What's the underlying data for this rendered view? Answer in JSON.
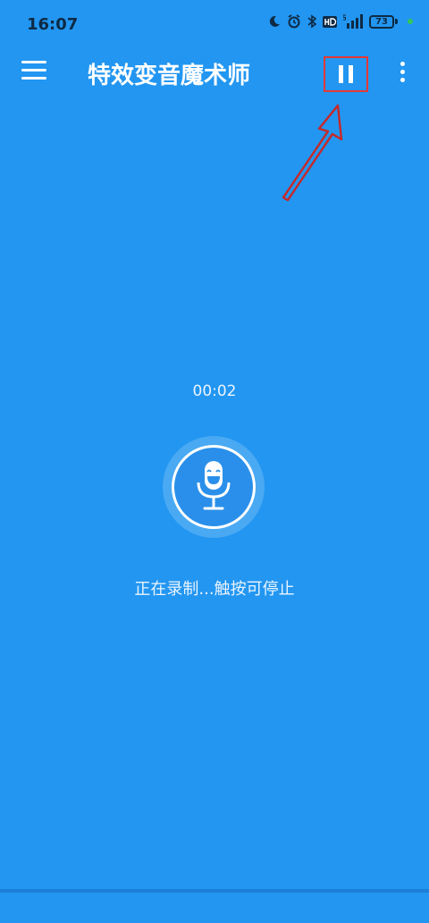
{
  "status": {
    "time": "16:07",
    "battery": "73"
  },
  "toolbar": {
    "title": "特效变音魔术师"
  },
  "recording": {
    "timer": "00:02",
    "hint": "正在录制...触按可停止"
  },
  "colors": {
    "background": "#2296F1",
    "highlight": "#E53935"
  }
}
